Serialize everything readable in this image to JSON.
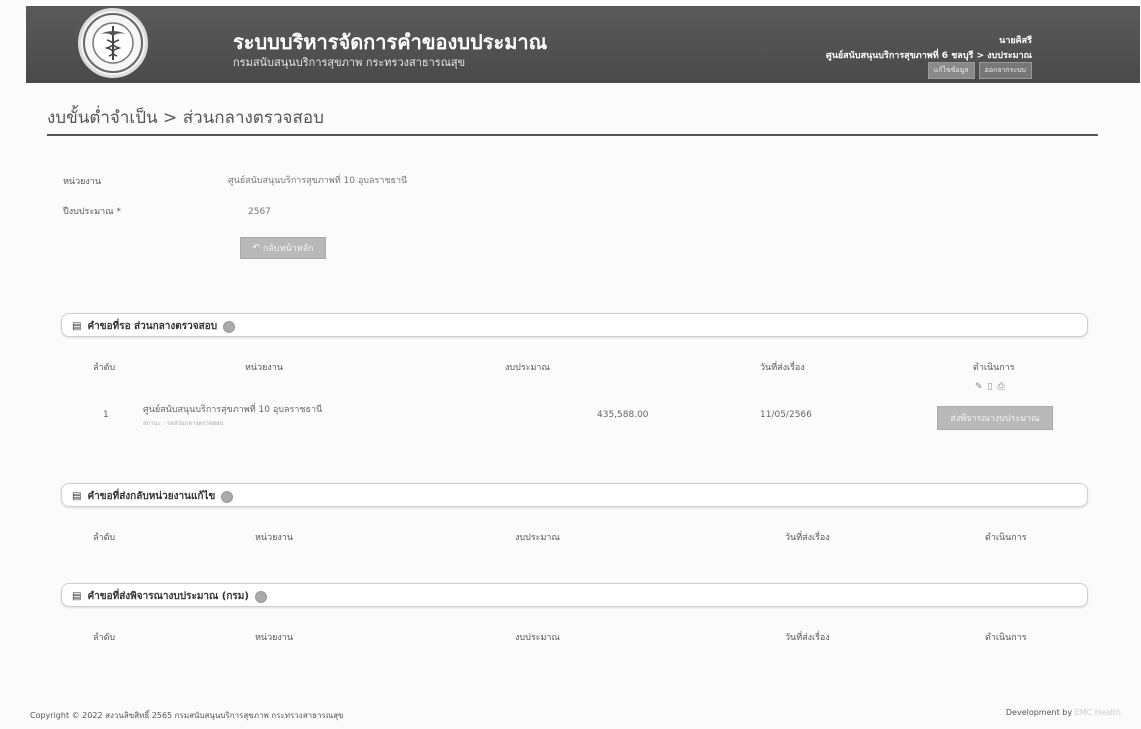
{
  "header": {
    "app_title": "ระบบบริหารจัดการคำของบประมาณ",
    "app_subtitle": "กรมสนับสนุนบริการสุขภาพ กระทรวงสาธารณสุข",
    "user_name": "นายคิสรี",
    "user_unit": "ศูนย์สนับสนุนบริการสุขภาพที่ 6 ชลบุรี > งบประมาณ",
    "btn_edit": "แก้ไขข้อมูล",
    "btn_logout": "ออกจากระบบ",
    "logo_icon": "ministry-of-public-health-seal"
  },
  "breadcrumb": "งบขั้นต่ำจำเป็น > ส่วนกลางตรวจสอบ",
  "form": {
    "unit_label": "หน่วยงาน",
    "unit_value": "ศูนย์สนับสนุนบริการสุขภาพที่ 10 อุบลราชธานี",
    "year_label": "ปีงบประมาณ *",
    "year_value": "2567",
    "back_button": "กลับหน้าหลัก"
  },
  "sections": [
    {
      "title": "คำขอที่รอ ส่วนกลางตรวจสอบ",
      "columns": [
        "ลำดับ",
        "หน่วยงาน",
        "งบประมาณ",
        "วันที่ส่งเรื่อง",
        "ดำเนินการ"
      ],
      "rows": [
        {
          "no": "1",
          "unit": "ศูนย์สนับสนุนบริการสุขภาพที่ 10 อุบลราชธานี",
          "status": "สถานะ : รอส่วนกลางตรวจสอบ",
          "budget": "435,588.00",
          "date": "11/05/2566",
          "action_button": "ส่งพิจารณางบประมาณ"
        }
      ]
    },
    {
      "title": "คำขอที่ส่งกลับหน่วยงานแก้ไข",
      "columns": [
        "ลำดับ",
        "หน่วยงาน",
        "งบประมาณ",
        "วันที่ส่งเรื่อง",
        "ดำเนินการ"
      ],
      "rows": []
    },
    {
      "title": "คำขอที่ส่งพิจารณางบประมาณ (กรม)",
      "columns": [
        "ลำดับ",
        "หน่วยงาน",
        "งบประมาณ",
        "วันที่ส่งเรื่อง",
        "ดำเนินการ"
      ],
      "rows": []
    }
  ],
  "footer": {
    "copyright": "Copyright © 2022 สงวนลิขสิทธิ์ 2565 กรมสนับสนุนบริการสุขภาพ กระทรวงสาธารณสุข",
    "dev_label": "Development by",
    "dev_name": "EMC Health"
  }
}
